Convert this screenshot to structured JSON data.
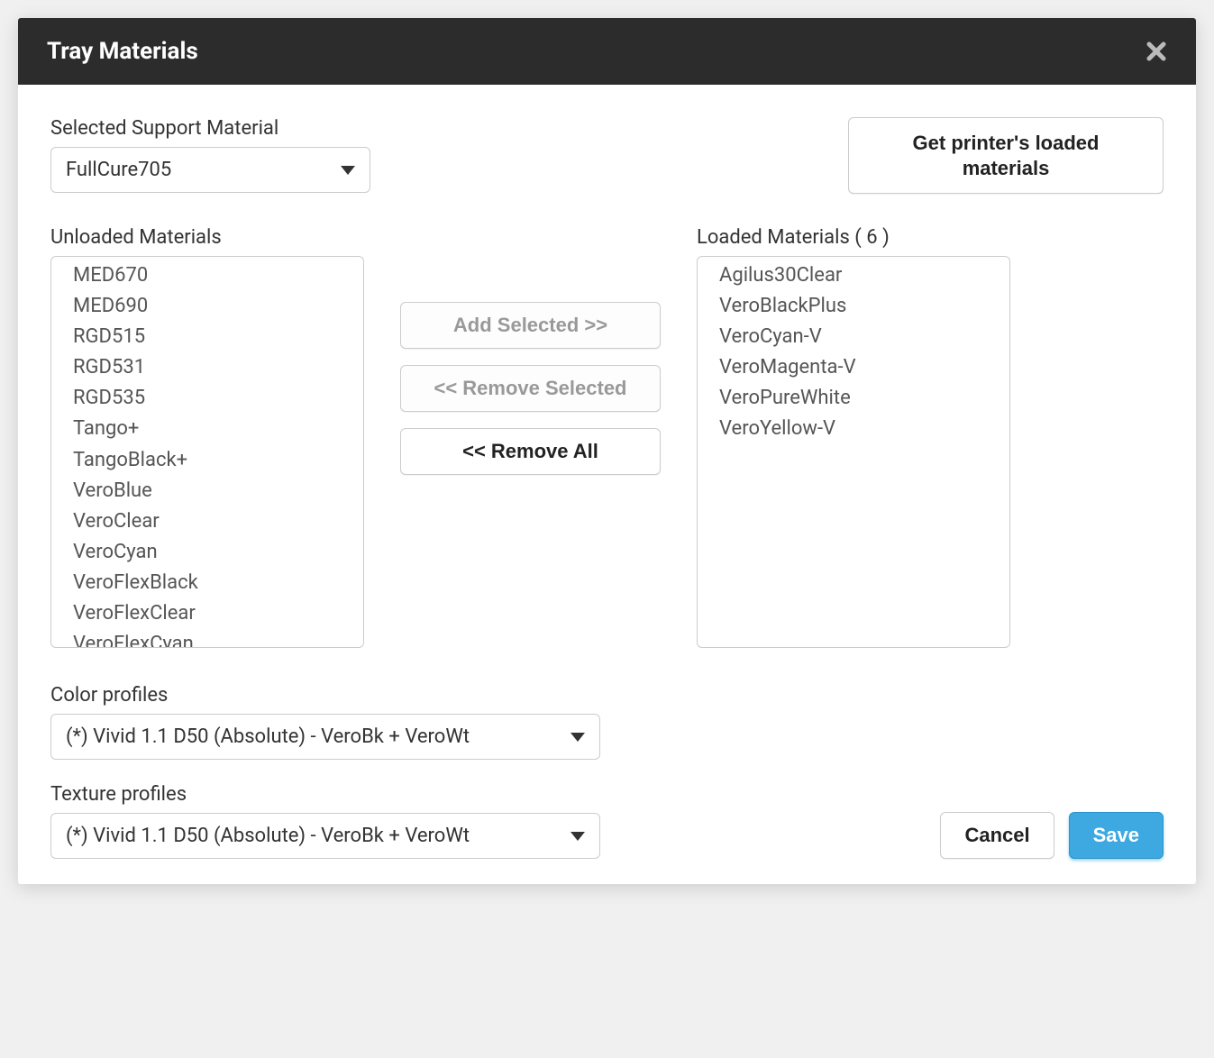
{
  "dialog": {
    "title": "Tray Materials"
  },
  "support_material": {
    "label": "Selected Support Material",
    "value": "FullCure705"
  },
  "get_loaded_btn": "Get printer's loaded materials",
  "unloaded": {
    "label": "Unloaded Materials",
    "items": [
      "MED670",
      "MED690",
      "RGD515",
      "RGD531",
      "RGD535",
      "Tango+",
      "TangoBlack+",
      "VeroBlue",
      "VeroClear",
      "VeroCyan",
      "VeroFlexBlack",
      "VeroFlexClear",
      "VeroFlexCyan"
    ]
  },
  "loaded": {
    "label": "Loaded Materials ( 6 )",
    "items": [
      "Agilus30Clear",
      "VeroBlackPlus",
      "VeroCyan-V",
      "VeroMagenta-V",
      "VeroPureWhite",
      "VeroYellow-V"
    ]
  },
  "transfer": {
    "add": "Add Selected >>",
    "remove": "<< Remove Selected",
    "remove_all": "<< Remove All"
  },
  "color_profiles": {
    "label": "Color profiles",
    "value": "(*) Vivid 1.1 D50 (Absolute) - VeroBk + VeroWt"
  },
  "texture_profiles": {
    "label": "Texture profiles",
    "value": "(*) Vivid 1.1 D50 (Absolute) - VeroBk + VeroWt"
  },
  "actions": {
    "cancel": "Cancel",
    "save": "Save"
  }
}
